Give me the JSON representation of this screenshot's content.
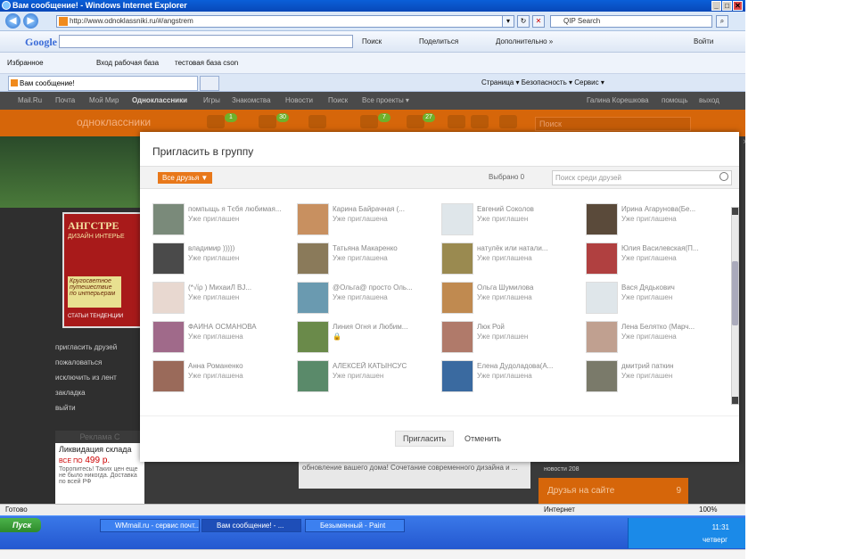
{
  "window": {
    "title": "Вам сообщение! - Windows Internet Explorer"
  },
  "browser": {
    "url": "http://www.odnoklassniki.ru/#/angstrem",
    "qip_placeholder": "QIP Search",
    "google_logo": "Google",
    "google_tools": [
      "Поиск",
      "Поделиться",
      "Дополнительно »",
      "Войти"
    ],
    "favorites": [
      "Избранное",
      "Вход рабочая база",
      "тестовая база cson"
    ],
    "active_tab": "Вам сообщение!",
    "ie_tools": "Страница ▾  Безопасность ▾  Сервис ▾"
  },
  "site": {
    "top_nav": [
      "Mail.Ru",
      "Почта",
      "Мой Мир",
      "Одноклассники",
      "Игры",
      "Знакомства",
      "Новости",
      "Поиск",
      "Все проекты ▾"
    ],
    "user": "Галина Корешкова",
    "user_links": [
      "помощь",
      "выход"
    ],
    "logo": "одноклассники",
    "badges": [
      "1",
      "30",
      "7",
      "27"
    ],
    "search_placeholder": "Поиск",
    "ad_title": "АНГСТРЕ",
    "ad_subtitle": "ДИЗАЙН ИНТЕРЬЕ",
    "ad_yellow": "Кругосветное путешествие по интерьерам",
    "ad_footer": "СТАТЬИ ТЕНДЕНЦИИ",
    "left_menu": [
      "пригласить друзей",
      "пожаловаться",
      "исключить из лент",
      "закладка",
      "выйти"
    ],
    "ads_header": "Реклама С",
    "ads_text": "Ликвидация склада",
    "ads_price": "499 р.",
    "ads_price_prefix": "ВСЕ ПО",
    "ads_desc": "Торопитесь! Таких цен еще не было никогда. Доставка по всей РФ",
    "bg_text": "обновление вашего дома! Сочетание современного дизайна и ...",
    "news_label": "новости 208",
    "friends_online": "Друзья на сайте",
    "friends_online_count": "9"
  },
  "modal": {
    "title": "Пригласить в группу",
    "filter": "Все друзья ▼",
    "selected": "Выбрано 0",
    "search_placeholder": "Поиск среди друзей",
    "invite": "Пригласить",
    "cancel": "Отменить",
    "friends": [
      {
        "name": "помпыщь я Тєбя любимая...",
        "status": "Уже приглашен",
        "color": "#7a8a7a"
      },
      {
        "name": "Карина Байрачная (...",
        "status": "Уже приглашена",
        "color": "#c89060"
      },
      {
        "name": "Евгений Соколов",
        "status": "Уже приглашен",
        "color": "#dfe6ea"
      },
      {
        "name": "Ирина Агарунова(Бе...",
        "status": "Уже приглашена",
        "color": "#5a4a3a"
      },
      {
        "name": "владимир )))))",
        "status": "Уже приглашен",
        "color": "#4a4a4a"
      },
      {
        "name": "Татьяна Макаренко",
        "status": "Уже приглашена",
        "color": "#8a7a5a"
      },
      {
        "name": "натулёк или натали...",
        "status": "Уже приглашена",
        "color": "#9a8a50"
      },
      {
        "name": "Юлия Василевская(П...",
        "status": "Уже приглашена",
        "color": "#b04040"
      },
      {
        "name": "(*√ίρ ) МихаиЛ ВЈ...",
        "status": "Уже приглашен",
        "color": "#e8d8d0"
      },
      {
        "name": "@Ольга@ просто Оль...",
        "status": "Уже приглашена",
        "color": "#6a9ab0"
      },
      {
        "name": "Ольга Шумилова",
        "status": "Уже приглашена",
        "color": "#c08a50"
      },
      {
        "name": "Вася Дядькович",
        "status": "Уже приглашен",
        "color": "#dfe6ea"
      },
      {
        "name": "ФАИНА ОСМАНОВА",
        "status": "Уже приглашена",
        "color": "#a06a8a"
      },
      {
        "name": "Линия Огня и Любим...",
        "status": "🔒",
        "color": "#6a8a4a"
      },
      {
        "name": "Люк Рой",
        "status": "Уже приглашен",
        "color": "#b07a6a"
      },
      {
        "name": "Лена Белятко (Марч...",
        "status": "Уже приглашена",
        "color": "#c0a090"
      },
      {
        "name": "Анна Романенко",
        "status": "Уже приглашена",
        "color": "#9a6a5a"
      },
      {
        "name": "АЛЕКСЕЙ КАТЫНСУС",
        "status": "Уже приглашен",
        "color": "#5a8a6a"
      },
      {
        "name": "Елена Дудоладова(А...",
        "status": "Уже приглашена",
        "color": "#3a6aa0"
      },
      {
        "name": "дмитрий паткин",
        "status": "Уже приглашен",
        "color": "#7a7a6a"
      }
    ]
  },
  "status_bar": {
    "text": "Готово",
    "zone": "Интернет",
    "zoom": "100%"
  },
  "taskbar": {
    "start": "Пуск",
    "tasks": [
      "WMmail.ru - сервис почт...",
      "Вам сообщение! - ...",
      "Безымянный - Paint"
    ],
    "time": "11:31",
    "day": "четверг"
  }
}
